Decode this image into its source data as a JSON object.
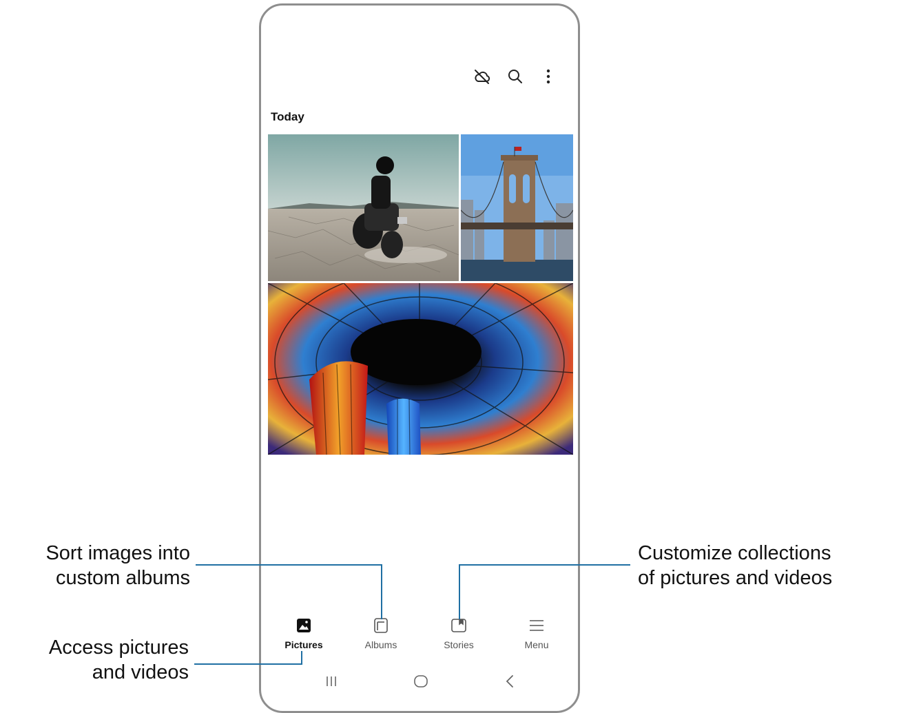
{
  "header": {
    "icons": [
      "cloud-off-icon",
      "search-icon",
      "more-options-icon"
    ]
  },
  "section_title": "Today",
  "photos": [
    {
      "name": "photo-motorcycle-desert"
    },
    {
      "name": "photo-brooklyn-bridge"
    },
    {
      "name": "photo-stained-glass-dome"
    }
  ],
  "bottom_nav": {
    "pictures": "Pictures",
    "albums": "Albums",
    "stories": "Stories",
    "menu": "Menu",
    "active": "Pictures"
  },
  "system_nav": [
    "recents-icon",
    "home-icon",
    "back-icon"
  ],
  "callouts": {
    "albums_line1": "Sort images into",
    "albums_line2": "custom albums",
    "pictures_line1": "Access pictures",
    "pictures_line2": "and videos",
    "stories_line1": "Customize collections",
    "stories_line2": "of pictures and videos"
  },
  "colors": {
    "leader_line": "#1f6fa3",
    "phone_frame": "#8e8e8e"
  }
}
